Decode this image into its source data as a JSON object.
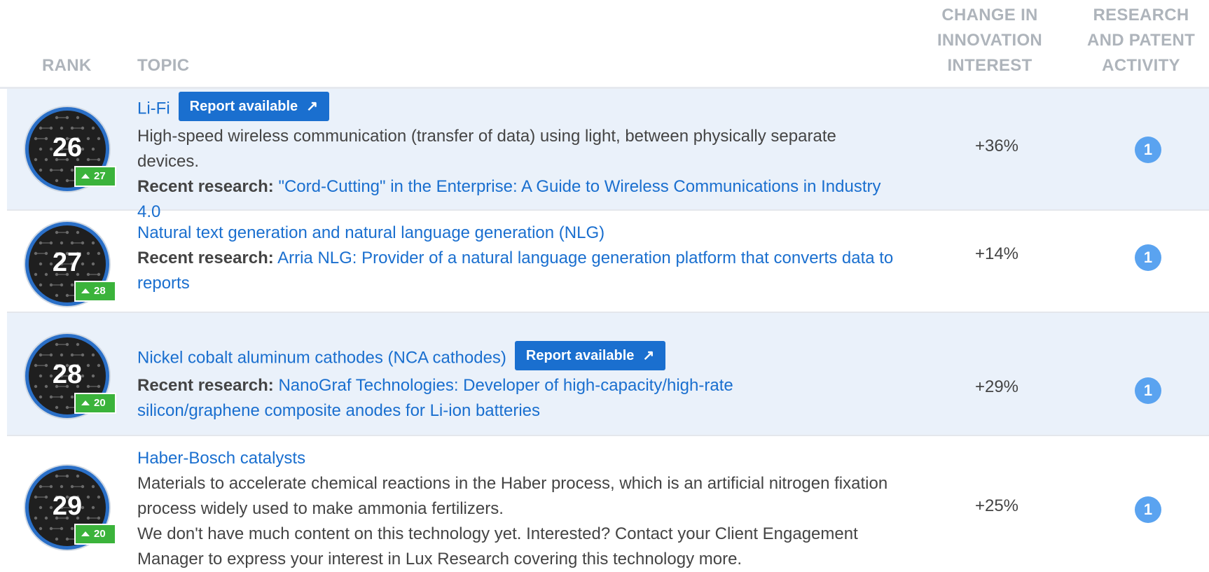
{
  "headers": {
    "rank": "RANK",
    "topic": "TOPIC",
    "change": "CHANGE IN INNOVATION INTEREST",
    "research": "RESEARCH AND PATENT ACTIVITY"
  },
  "recent_research_label": "Recent research:",
  "report_label": "Report available",
  "icons": {
    "report": "external-link-icon",
    "rank_up": "triangle-up-icon"
  },
  "colors": {
    "accent": "#1a6fcf",
    "rank_up": "#3bb33b",
    "alt_row": "#eaf1fa",
    "count": "#5aa3f0"
  },
  "rows": [
    {
      "rank": "26",
      "prev_rank": "27",
      "title": "Li-Fi",
      "report_available": true,
      "description": "High-speed wireless communication (transfer of data) using light, between physically separate devices.",
      "recent_research": "\"Cord-Cutting\" in the Enterprise: A Guide to Wireless Communications in Industry 4.0",
      "change": "+36%",
      "activity": "1"
    },
    {
      "rank": "27",
      "prev_rank": "28",
      "title": "Natural text generation and natural language generation (NLG)",
      "report_available": false,
      "description": "",
      "recent_research": "Arria NLG: Provider of a natural language generation platform that converts data to reports",
      "change": "+14%",
      "activity": "1"
    },
    {
      "rank": "28",
      "prev_rank": "20",
      "title": "Nickel cobalt aluminum cathodes (NCA cathodes)",
      "report_available": true,
      "description": "",
      "recent_research": "NanoGraf Technologies: Developer of high-capacity/high-rate silicon/graphene composite anodes for Li-ion batteries",
      "change": "+29%",
      "activity": "1"
    },
    {
      "rank": "29",
      "prev_rank": "20",
      "title": "Haber-Bosch catalysts",
      "report_available": false,
      "description": "Materials to accelerate chemical reactions in the Haber process, which is an artificial nitrogen fixation process widely used to make ammonia fertilizers.",
      "note": "We don't have much content on this technology yet. Interested? Contact your Client Engagement Manager to express your interest in Lux Research covering this technology more.",
      "change": "+25%",
      "activity": "1"
    }
  ]
}
